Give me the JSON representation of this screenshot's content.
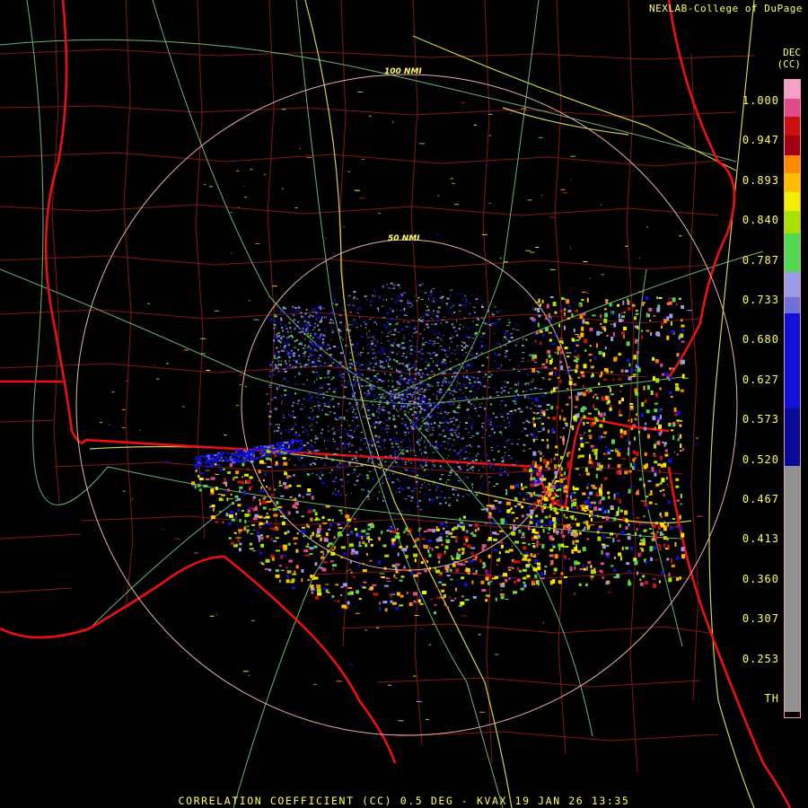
{
  "credit": "NEXLAB-College of DuPage",
  "product": {
    "line1": "DEC",
    "line2": "(CC)"
  },
  "range_rings": [
    {
      "label": "100 NMI"
    },
    {
      "label": "50 NMI"
    }
  ],
  "legend": {
    "labels": [
      "1.000",
      "0.947",
      "0.893",
      "0.840",
      "0.787",
      "0.733",
      "0.680",
      "0.627",
      "0.573",
      "0.520",
      "0.467",
      "0.413",
      "0.360",
      "0.307",
      "0.253",
      "TH"
    ],
    "colors": {
      "pink": "#f4a0c8",
      "magenta": "#e04a8c",
      "red": "#cc1010",
      "darkred": "#a00010",
      "orange": "#ff8a00",
      "amber": "#ffbe00",
      "yellow": "#f0f000",
      "lime": "#a8e000",
      "green": "#50d850",
      "lavender": "#9a9ae8",
      "periwinkle": "#7070d8",
      "blue": "#1010d8",
      "navy": "#0a0a98",
      "gray": "#909090",
      "black": "#000000"
    }
  },
  "footer": "CORRELATION COEFFICIENT (CC) 0.5 DEG - KVAX 19 JAN 26 13:35"
}
